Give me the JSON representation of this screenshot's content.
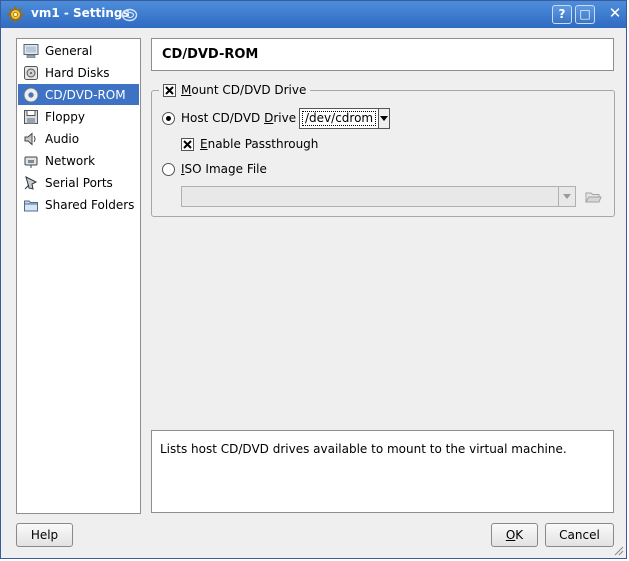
{
  "window": {
    "title": "vm1 - Settings",
    "help_button": "?",
    "maximize_button": "□",
    "close_button": "✕"
  },
  "sidebar": {
    "items": [
      {
        "label": "General",
        "icon": "monitor-icon",
        "selected": false
      },
      {
        "label": "Hard Disks",
        "icon": "hard-disk-icon",
        "selected": false
      },
      {
        "label": "CD/DVD-ROM",
        "icon": "cd-icon",
        "selected": true
      },
      {
        "label": "Floppy",
        "icon": "floppy-icon",
        "selected": false
      },
      {
        "label": "Audio",
        "icon": "speaker-icon",
        "selected": false
      },
      {
        "label": "Network",
        "icon": "network-icon",
        "selected": false
      },
      {
        "label": "Serial Ports",
        "icon": "serial-port-icon",
        "selected": false
      },
      {
        "label": "Shared Folders",
        "icon": "folder-icon",
        "selected": false
      }
    ]
  },
  "content": {
    "title": "CD/DVD-ROM",
    "mount": {
      "label_prefix": "",
      "label_mnemonic": "M",
      "label_rest": "ount CD/DVD Drive",
      "checked": true
    },
    "host_drive": {
      "label_prefix": "Host CD/DVD ",
      "label_mnemonic": "D",
      "label_rest": "rive",
      "selected": true,
      "value": "/dev/cdrom"
    },
    "passthrough": {
      "label_prefix": "",
      "label_mnemonic": "E",
      "label_rest": "nable Passthrough",
      "checked": true
    },
    "iso": {
      "label_prefix": "",
      "label_mnemonic": "I",
      "label_rest": "SO Image File",
      "selected": false,
      "value": ""
    }
  },
  "info": {
    "text": "Lists host CD/DVD drives available to mount to the virtual machine."
  },
  "buttons": {
    "help": "Help",
    "ok_mnemonic": "O",
    "ok_rest": "K",
    "cancel": "Cancel"
  },
  "colors": {
    "titlebar": "#3d7ad1",
    "selection": "#3d72c4"
  }
}
